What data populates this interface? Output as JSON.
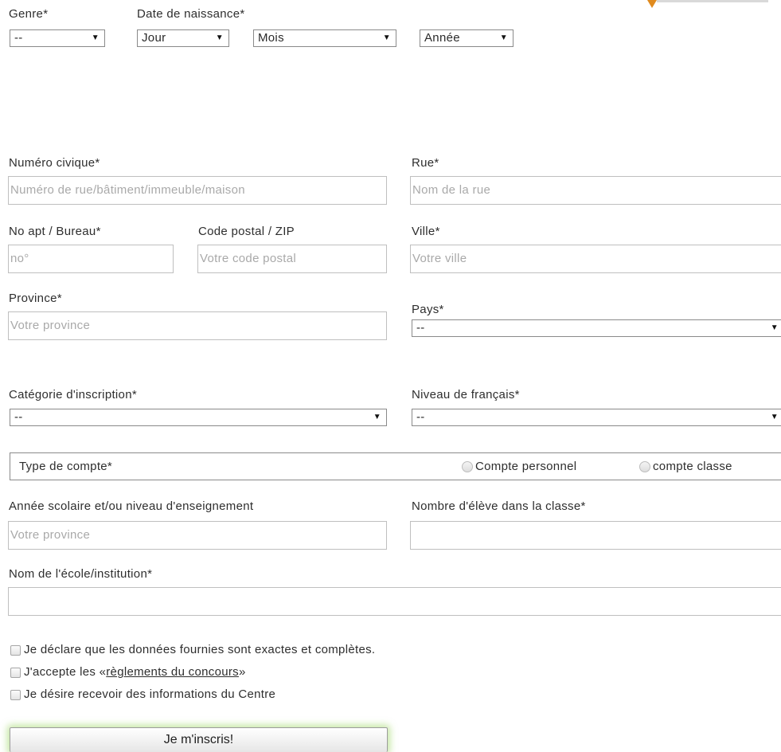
{
  "identity": {
    "genre_label": "Genre*",
    "genre_value": "--",
    "birth_label": "Date de naissance*",
    "day_value": "Jour",
    "month_value": "Mois",
    "year_value": "Année"
  },
  "address": {
    "civic_label": "Numéro civique*",
    "civic_placeholder": "Numéro de rue/bâtiment/immeuble/maison",
    "street_label": "Rue*",
    "street_placeholder": "Nom de la rue",
    "apt_label": "No apt / Bureau*",
    "apt_placeholder": "no°",
    "postal_label": "Code postal / ZIP",
    "postal_placeholder": "Votre code postal",
    "city_label": "Ville*",
    "city_placeholder": "Votre ville",
    "province_label": "Province*",
    "province_placeholder": "Votre province",
    "country_label": "Pays*",
    "country_value": "--"
  },
  "registration": {
    "category_label": "Catégorie d'inscription*",
    "category_value": "--",
    "french_label": "Niveau de français*",
    "french_value": "--",
    "account_type_label": "Type de compte*",
    "account_personal": "Compte personnel",
    "account_class": "compte classe"
  },
  "school": {
    "year_label": "Année scolaire et/ou niveau d'enseignement",
    "year_placeholder": "Votre province",
    "students_label": "Nombre d'élève dans la classe*",
    "institution_label": "Nom de l'école/institution*"
  },
  "consent": {
    "declare": "Je déclare que les données fournies sont exactes et complètes.",
    "accept_prefix": "J'accepte les «",
    "accept_link": "règlements du concours",
    "accept_suffix": "»",
    "info": "Je désire recevoir des informations du Centre"
  },
  "submit_label": "Je m'inscris!",
  "icons": {
    "dropdown": "▼"
  },
  "colors": {
    "submit_glow": "#96d25a",
    "accent_arrow": "#e08a1e"
  }
}
